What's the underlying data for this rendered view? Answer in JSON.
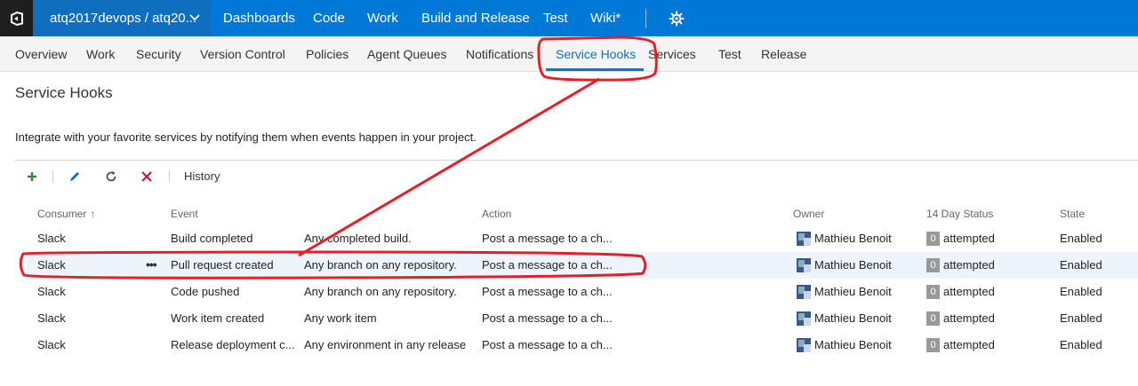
{
  "topbar": {
    "project": "atq2017devops / atq20...",
    "items": [
      "Dashboards",
      "Code",
      "Work",
      "Build and Release",
      "Test",
      "Wiki*"
    ]
  },
  "admin_tabs": [
    "Overview",
    "Work",
    "Security",
    "Version Control",
    "Policies",
    "Agent Queues",
    "Notifications",
    "Service Hooks",
    "Services",
    "Test",
    "Release"
  ],
  "active_tab": "Service Hooks",
  "page": {
    "title": "Service Hooks",
    "intro": "Integrate with your favorite services by notifying them when events happen in your project."
  },
  "toolbar": {
    "add_icon": "plus-icon",
    "edit_icon": "pencil-icon",
    "refresh_icon": "refresh-icon",
    "delete_icon": "close-icon",
    "history_label": "History"
  },
  "table": {
    "headers": {
      "consumer": "Consumer",
      "event": "Event",
      "action": "Action",
      "owner": "Owner",
      "status": "14 Day Status",
      "state": "State"
    },
    "sort": "Consumer ascending",
    "rows": [
      {
        "consumer": "Slack",
        "event": "Build completed",
        "filter": "Any completed build.",
        "action": "Post a message to a ch...",
        "owner": "Mathieu Benoit",
        "count": "0",
        "status": "attempted",
        "state": "Enabled"
      },
      {
        "consumer": "Slack",
        "event": "Pull request created",
        "filter": "Any branch on any repository.",
        "action": "Post a message to a ch...",
        "owner": "Mathieu Benoit",
        "count": "0",
        "status": "attempted",
        "state": "Enabled"
      },
      {
        "consumer": "Slack",
        "event": "Code pushed",
        "filter": "Any branch on any repository.",
        "action": "Post a message to a ch...",
        "owner": "Mathieu Benoit",
        "count": "0",
        "status": "attempted",
        "state": "Enabled"
      },
      {
        "consumer": "Slack",
        "event": "Work item created",
        "filter": "Any work item",
        "action": "Post a message to a ch...",
        "owner": "Mathieu Benoit",
        "count": "0",
        "status": "attempted",
        "state": "Enabled"
      },
      {
        "consumer": "Slack",
        "event": "Release deployment c...",
        "filter": "Any environment in any release",
        "action": "Post a message to a ch...",
        "owner": "Mathieu Benoit",
        "count": "0",
        "status": "attempted",
        "state": "Enabled"
      }
    ],
    "row_menu": "•••"
  },
  "colors": {
    "topbar": "#0078d7",
    "project_bg": "#106ebe",
    "logo_bg": "#1e1e1e",
    "annotation": "#e3202a",
    "add": "#2e8b2e",
    "delete": "#c8102e"
  }
}
